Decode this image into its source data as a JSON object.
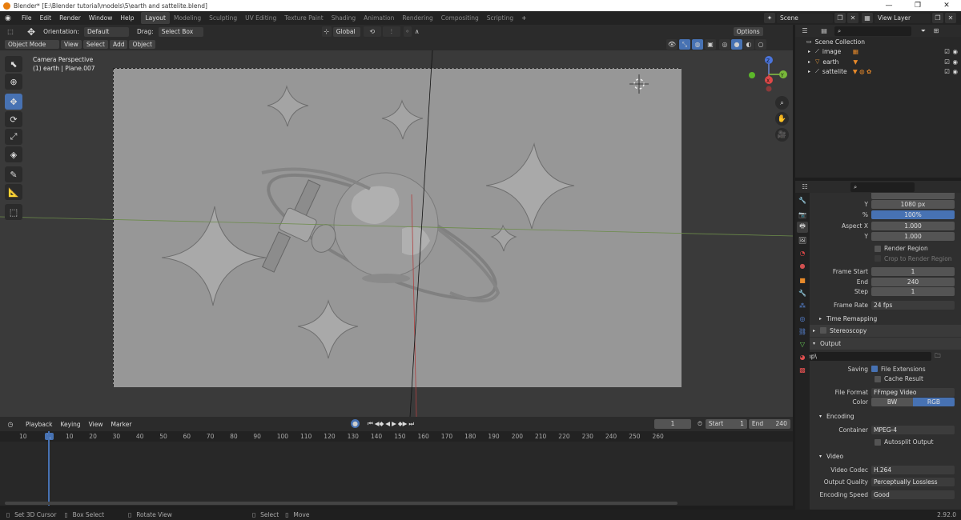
{
  "window": {
    "title": "Blender* [E:\\Blender tutorial\\models\\5\\earth and sattelite.blend]",
    "minimize": "—",
    "maximize": "❐",
    "close": "✕"
  },
  "menu": [
    "File",
    "Edit",
    "Render",
    "Window",
    "Help"
  ],
  "workspaces": [
    "Layout",
    "Modeling",
    "Sculpting",
    "UV Editing",
    "Texture Paint",
    "Shading",
    "Animation",
    "Rendering",
    "Compositing",
    "Scripting"
  ],
  "active_workspace": "Layout",
  "scene": {
    "name": "Scene",
    "view_layer": "View Layer"
  },
  "header": {
    "orientation_label": "Orientation:",
    "orientation": "Default",
    "drag_label": "Drag:",
    "drag": "Select Box",
    "transform": "Global",
    "options": "Options"
  },
  "viewport_menu": {
    "mode": "Object Mode",
    "view": "View",
    "select": "Select",
    "add": "Add",
    "object": "Object"
  },
  "viewport": {
    "perspective": "Camera Perspective",
    "object_info": "(1) earth | Plane.007"
  },
  "gizmo": {
    "x": "X",
    "y": "Y",
    "z": "Z"
  },
  "timeline": {
    "playback": "Playback",
    "keying": "Keying",
    "view": "View",
    "marker": "Marker",
    "current_frame": "1",
    "start_label": "Start",
    "start": "1",
    "end_label": "End",
    "end": "240",
    "ruler": [
      "10",
      "1",
      "10",
      "20",
      "30",
      "40",
      "50",
      "60",
      "70",
      "80",
      "90",
      "100",
      "110",
      "120",
      "130",
      "140",
      "150",
      "160",
      "170",
      "180",
      "190",
      "200",
      "210",
      "220",
      "230",
      "240",
      "250",
      "260"
    ]
  },
  "status": {
    "left1": "Set 3D Cursor",
    "left2": "Box Select",
    "left3": "Rotate View",
    "mid1": "Select",
    "mid2": "Move",
    "version": "2.92.0"
  },
  "outliner": {
    "root": "Scene Collection",
    "items": [
      {
        "name": "image"
      },
      {
        "name": "earth"
      },
      {
        "name": "sattelite"
      }
    ]
  },
  "props": {
    "res_y_label": "Y",
    "res_y": "1080 px",
    "percent_label": "%",
    "percent": "100%",
    "aspect_x_label": "Aspect X",
    "aspect_x": "1.000",
    "aspect_y_label": "Y",
    "aspect_y": "1.000",
    "render_region": "Render Region",
    "crop": "Crop to Render Region",
    "frame_start_label": "Frame Start",
    "frame_start": "1",
    "end_label": "End",
    "end": "240",
    "step_label": "Step",
    "step": "1",
    "frame_rate_label": "Frame Rate",
    "frame_rate": "24 fps",
    "time_remap": "Time Remapping",
    "stereoscopy": "Stereoscopy",
    "output": "Output",
    "path": "/tmp\\",
    "saving_label": "Saving",
    "file_ext": "File Extensions",
    "cache": "Cache Result",
    "file_format_label": "File Format",
    "file_format": "FFmpeg Video",
    "color_label": "Color",
    "bw": "BW",
    "rgb": "RGB",
    "encoding": "Encoding",
    "container_label": "Container",
    "container": "MPEG-4",
    "autosplit": "Autosplit Output",
    "video": "Video",
    "codec_label": "Video Codec",
    "codec": "H.264",
    "quality_label": "Output Quality",
    "quality": "Perceptually Lossless",
    "speed_label": "Encoding Speed",
    "speed": "Good"
  },
  "colors": {
    "accent": "#4772b3",
    "bg": "#303030",
    "header": "#2b2b2b"
  }
}
